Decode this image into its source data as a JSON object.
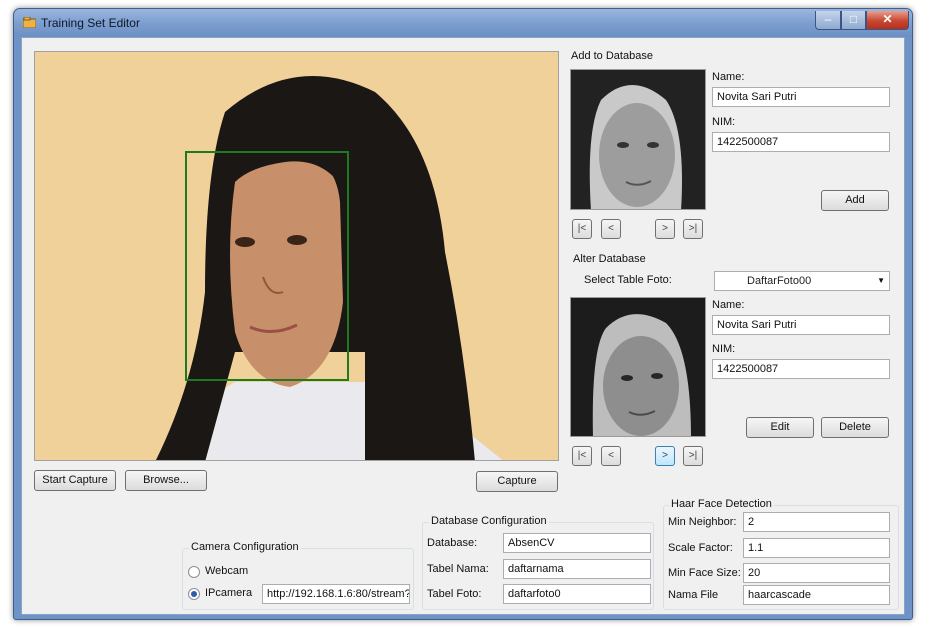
{
  "window": {
    "title": "Training Set Editor",
    "minimize": "–",
    "maximize": "□",
    "close": "✕"
  },
  "main": {
    "start_capture": "Start Capture",
    "browse": "Browse...",
    "capture": "Capture"
  },
  "add_db": {
    "title": "Add to Database",
    "name_label": "Name:",
    "name_value": "Novita Sari Putri",
    "nim_label": "NIM:",
    "nim_value": "1422500087",
    "add_button": "Add",
    "nav": [
      "|<",
      "<",
      ">",
      ">|"
    ]
  },
  "alter_db": {
    "title": "Alter Database",
    "select_label": "Select Table Foto:",
    "select_value": "DaftarFoto00",
    "name_label": "Name:",
    "name_value": "Novita Sari Putri",
    "nim_label": "NIM:",
    "nim_value": "1422500087",
    "edit_button": "Edit",
    "delete_button": "Delete",
    "nav": [
      "|<",
      "<",
      ">",
      ">|"
    ]
  },
  "camera": {
    "title": "Camera Configuration",
    "webcam": "Webcam",
    "ipcamera": "IPcamera",
    "ip_url": "http://192.168.1.6:80/stream?u",
    "selected": "IPcamera"
  },
  "database": {
    "title": "Database Configuration",
    "database_label": "Database:",
    "database_value": "AbsenCV",
    "tabel_nama_label": "Tabel Nama:",
    "tabel_nama_value": "daftarnama",
    "tabel_foto_label": "Tabel Foto:",
    "tabel_foto_value": "daftarfoto0"
  },
  "haar": {
    "title": "Haar Face Detection",
    "min_neighbor_label": "Min Neighbor:",
    "min_neighbor_value": "2",
    "scale_factor_label": "Scale Factor:",
    "scale_factor_value": "1.1",
    "min_face_label": "Min Face Size:",
    "min_face_value": "20",
    "nama_file_label": "Nama File",
    "nama_file_value": "haarcascade"
  },
  "icons": {
    "app": "app-icon",
    "dropdown": "chevron-down-icon"
  },
  "colors": {
    "title_bar": "#7a9cce",
    "face_box": "#1e7a1e",
    "close": "#c94632"
  }
}
